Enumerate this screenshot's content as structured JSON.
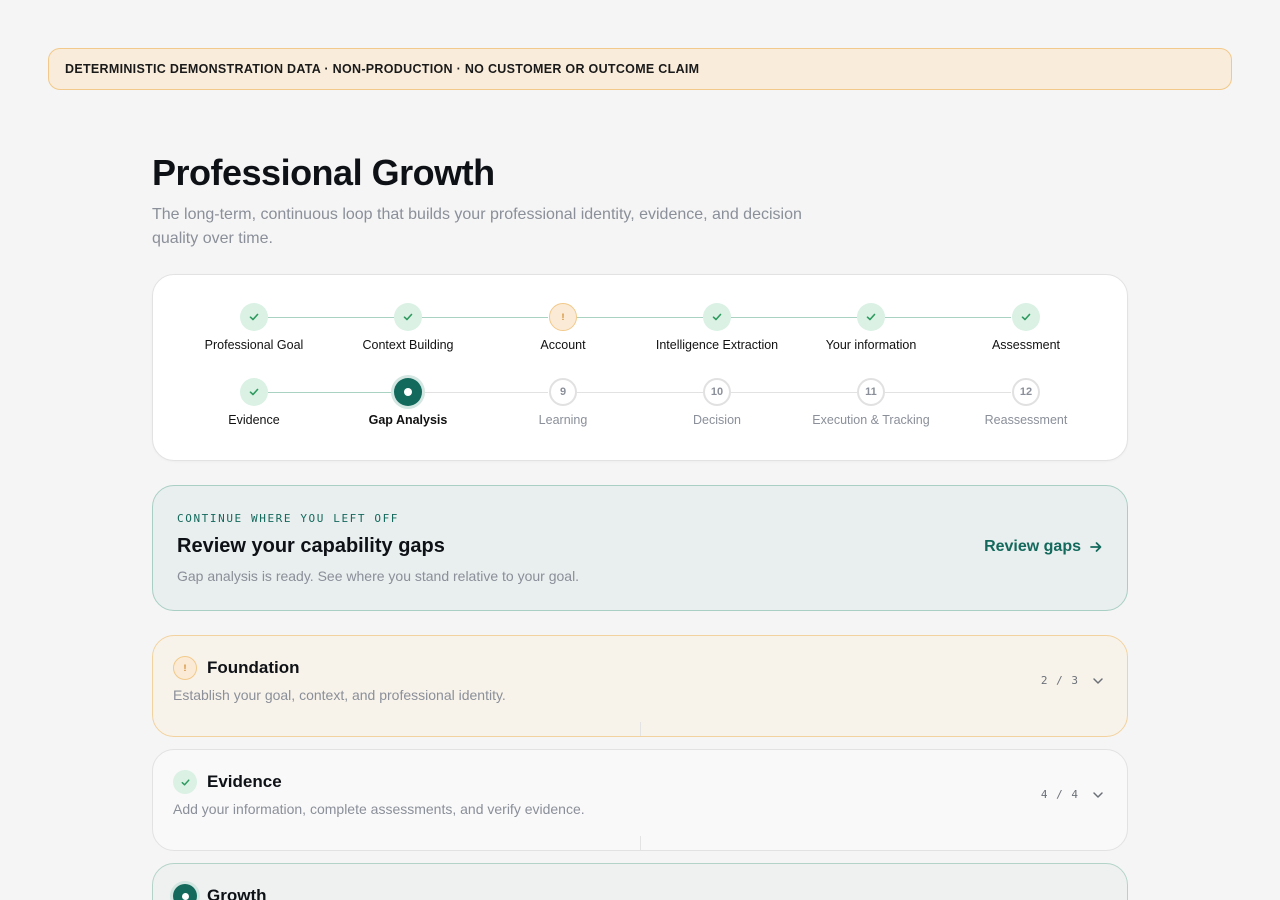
{
  "banner": {
    "text": "DETERMINISTIC DEMONSTRATION DATA · NON-PRODUCTION · NO CUSTOMER OR OUTCOME CLAIM"
  },
  "page": {
    "title": "Professional Growth",
    "subtitle": "The long-term, continuous loop that builds your professional identity, evidence, and decision quality over time."
  },
  "stepper": {
    "steps": [
      {
        "label": "Professional Goal",
        "status": "done"
      },
      {
        "label": "Context Building",
        "status": "done"
      },
      {
        "label": "Account",
        "status": "warning",
        "mark": "!"
      },
      {
        "label": "Intelligence Extraction",
        "status": "done"
      },
      {
        "label": "Your information",
        "status": "done"
      },
      {
        "label": "Assessment",
        "status": "done"
      },
      {
        "label": "Evidence",
        "status": "done"
      },
      {
        "label": "Gap Analysis",
        "status": "active"
      },
      {
        "label": "Learning",
        "status": "todo",
        "number": "9"
      },
      {
        "label": "Decision",
        "status": "todo",
        "number": "10"
      },
      {
        "label": "Execution & Tracking",
        "status": "todo",
        "number": "11"
      },
      {
        "label": "Reassessment",
        "status": "todo",
        "number": "12"
      }
    ]
  },
  "continue": {
    "eyebrow": "CONTINUE WHERE YOU LEFT OFF",
    "heading": "Review your capability gaps",
    "description": "Gap analysis is ready. See where you stand relative to your goal.",
    "cta_label": "Review gaps"
  },
  "phases": [
    {
      "title": "Foundation",
      "description": "Establish your goal, context, and professional identity.",
      "count": "2 / 3",
      "status": "warning",
      "mark": "!"
    },
    {
      "title": "Evidence",
      "description": "Add your information, complete assessments, and verify evidence.",
      "count": "4 / 4",
      "status": "done"
    },
    {
      "title": "Growth",
      "description": "",
      "count": "",
      "status": "active"
    }
  ],
  "icons": {
    "check": "check-icon",
    "warning": "warning-icon",
    "arrow": "arrow-right-icon",
    "chevron": "chevron-down-icon"
  },
  "colors": {
    "accent": "#13695c",
    "done": "#2e9a5f",
    "warning": "#d28a2c",
    "banner_bg": "#f9ecdb"
  }
}
